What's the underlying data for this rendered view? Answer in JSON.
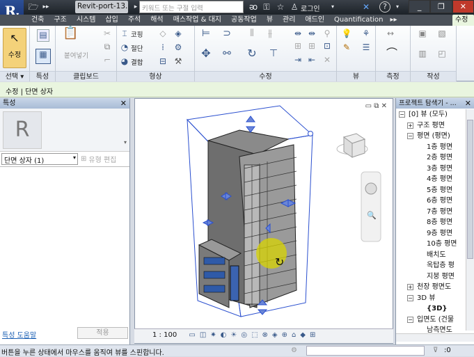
{
  "titlebar": {
    "doc_title": "Revit-port-13...",
    "search_placeholder": "키워드 또는 구절 입력",
    "login": "로그인"
  },
  "tabs": [
    "건축",
    "구조",
    "시스템",
    "삽입",
    "주석",
    "해석",
    "매스작업 & 대지",
    "공동작업",
    "뷰",
    "관리",
    "애드인",
    "Quantification"
  ],
  "active_tab": "수정",
  "ribbon": {
    "modify_label": "수정",
    "select_label": "선택 ▾",
    "properties_label": "특성",
    "clipboard_label": "클립보드",
    "paste_label": "붙여넣기",
    "geometry_label": "형상",
    "cope_label": "코핑",
    "cut_label": "절단",
    "join_label": "결합",
    "modify_panel_label": "수정",
    "view_label": "뷰",
    "measure_label": "측정",
    "create_label": "작성"
  },
  "context_bar": "수정 | 단면 상자",
  "properties": {
    "title": "특성",
    "type_value": "단면 상자 (1)",
    "edit_type": "유형 편집",
    "help_link": "특성 도움말",
    "apply_button": "적용"
  },
  "viewbar": {
    "scale": "1 : 100"
  },
  "project_browser": {
    "title": "프로젝트 탐색기 - ...",
    "items": [
      {
        "label": "[0] 뷰 (모두)",
        "level": 0,
        "exp": "−"
      },
      {
        "label": "구조 평면",
        "level": 1,
        "exp": "+"
      },
      {
        "label": "평면 (평면)",
        "level": 1,
        "exp": "−"
      },
      {
        "label": "1층 평면",
        "level": 2
      },
      {
        "label": "2층 평면",
        "level": 2
      },
      {
        "label": "3층 평면",
        "level": 2
      },
      {
        "label": "4층 평면",
        "level": 2
      },
      {
        "label": "5층 평면",
        "level": 2
      },
      {
        "label": "6층 평면",
        "level": 2
      },
      {
        "label": "7층 평면",
        "level": 2
      },
      {
        "label": "8층 평면",
        "level": 2
      },
      {
        "label": "9층 평면",
        "level": 2
      },
      {
        "label": "10층 평면",
        "level": 2
      },
      {
        "label": "배치도",
        "level": 2
      },
      {
        "label": "옥탑층 평",
        "level": 2
      },
      {
        "label": "지붕 평면",
        "level": 2
      },
      {
        "label": "천장 평면도",
        "level": 1,
        "exp": "+"
      },
      {
        "label": "3D 뷰",
        "level": 1,
        "exp": "−"
      },
      {
        "label": "{3D}",
        "level": 2,
        "bold": true
      },
      {
        "label": "입면도 (건물",
        "level": 1,
        "exp": "−"
      },
      {
        "label": "남측면도",
        "level": 2
      }
    ]
  },
  "status": {
    "message": "버튼을 누른 상태에서 마우스를 움직여 뷰를 스핀합니다.",
    "selection_count": ":0"
  },
  "colors": {
    "accent_tab": "#e9f5df",
    "modify_button": "#f4d27a"
  }
}
